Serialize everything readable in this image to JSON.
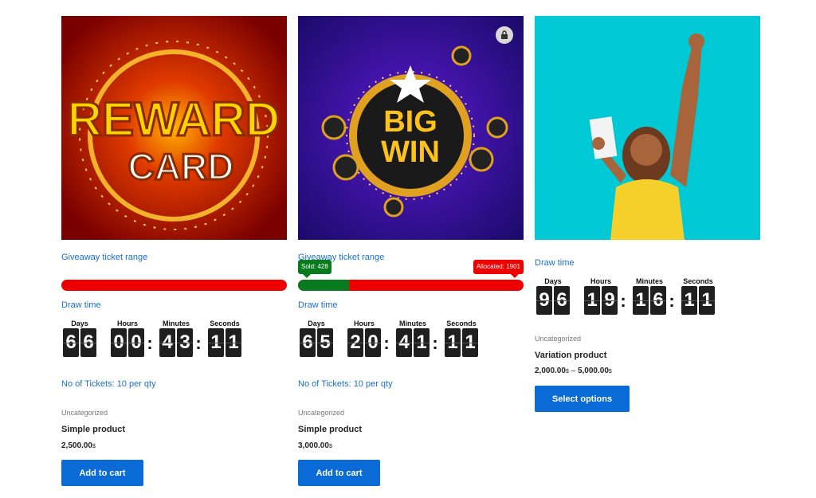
{
  "products": [
    {
      "image_alt": "REWARD CARD",
      "image_text_top": "REWARD",
      "image_text_bottom": "CARD",
      "range_link": "Giveaway ticket range",
      "draw_link": "Draw time",
      "timer": {
        "days": "66",
        "hours": "00",
        "minutes": "43",
        "seconds": "11"
      },
      "tickets": "No of Tickets: 10 per qty",
      "category": "Uncategorized",
      "title": "Simple product",
      "price": "2,500.00",
      "currency": "$",
      "button": "Add to cart"
    },
    {
      "image_text_top": "BIG",
      "image_text_bottom": "WIN",
      "range_link": "Giveaway ticket range",
      "sold_label": "Sold: 428",
      "allocated_label": "Allocated: 1901",
      "sold_fraction": 0.225,
      "draw_link": "Draw time",
      "timer": {
        "days": "65",
        "hours": "20",
        "minutes": "41",
        "seconds": "11"
      },
      "tickets": "No of Tickets: 10 per qty",
      "category": "Uncategorized",
      "title": "Simple product",
      "price": "3,000.00",
      "currency": "$",
      "button": "Add to cart",
      "badge_icon": "lock-bag-icon"
    },
    {
      "draw_link": "Draw time",
      "timer": {
        "days": "96",
        "hours": "19",
        "minutes": "16",
        "seconds": "11"
      },
      "category": "Uncategorized",
      "title": "Variation product",
      "price_min": "2,000.00",
      "price_sep": "–",
      "price_max": "5,000.00",
      "currency": "$",
      "button": "Select options"
    }
  ],
  "timer_labels": {
    "days": "Days",
    "hours": "Hours",
    "minutes": "Minutes",
    "seconds": "Seconds"
  },
  "colors": {
    "link": "#1a6fc9",
    "button": "#0a6bd6",
    "bar_red": "#ee0000",
    "bar_green": "#0a7a1e",
    "cyan_bg": "#00c8d4"
  }
}
